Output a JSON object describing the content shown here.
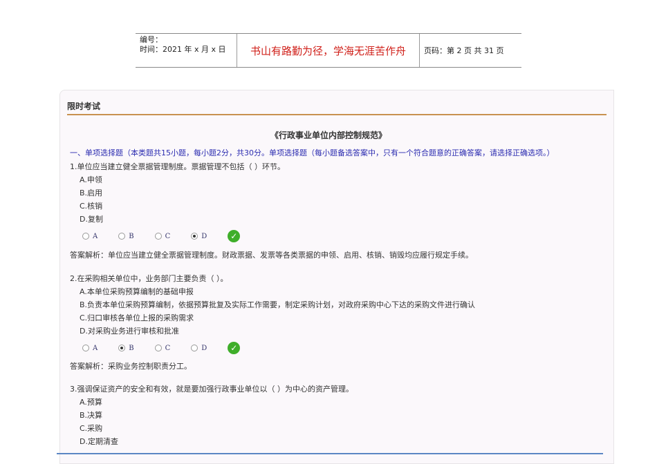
{
  "header": {
    "number_label": "编号：",
    "time_label": "时间：2021 年 x 月 x 日",
    "motto": "书山有路勤为径，学海无涯苦作舟",
    "page_info": "页码：第 2 页  共 31 页"
  },
  "exam": {
    "title": "限时考试",
    "doc_title": "《行政事业单位内部控制规范》",
    "section": "一、单项选择题（本类题共15小题，每小题2分，共30分。单项选择题（每小题备选答案中，只有一个符合题意的正确答案，请选择正确选项。）"
  },
  "questions": [
    {
      "text": "1.单位应当建立健全票据管理制度。票据管理不包括（ ）环节。",
      "options": [
        "A.申领",
        "B.启用",
        "C.核销",
        "D.复制"
      ],
      "radio_labels": [
        "A",
        "B",
        "C",
        "D"
      ],
      "selected": "D",
      "correct": true,
      "analysis": "答案解析：单位应当建立健全票据管理制度。财政票据、发票等各类票据的申领、启用、核销、销毁均应履行规定手续。"
    },
    {
      "text": "2.在采购相关单位中，业务部门主要负责（ ）。",
      "options": [
        "A.本单位采购预算编制的基础申报",
        "B.负责本单位采购预算编制，依据预算批复及实际工作需要，制定采购计划，对政府采购中心下达的采购文件进行确认",
        "C.归口审核各单位上报的采购需求",
        "D.对采购业务进行审核和批准"
      ],
      "radio_labels": [
        "A",
        "B",
        "C",
        "D"
      ],
      "selected": "B",
      "correct": true,
      "analysis": "答案解析：采购业务控制职责分工。"
    },
    {
      "text": "3.强调保证资产的安全和有效，就是要加强行政事业单位以（ ）为中心的资产管理。",
      "options": [
        "A.预算",
        "B.决算",
        "C.采购",
        "D.定期清查"
      ]
    }
  ],
  "colors": {
    "motto": "#d0201a",
    "section": "#2b2bb0",
    "rule": "#c8914f",
    "check": "#3fae2a"
  }
}
